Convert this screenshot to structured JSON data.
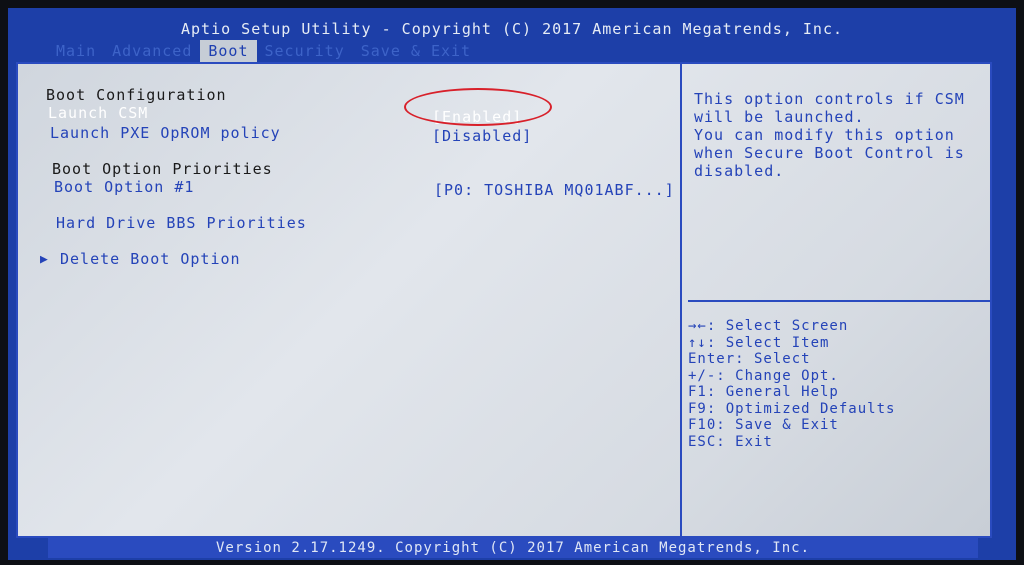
{
  "title": "Aptio Setup Utility - Copyright (C) 2017 American Megatrends, Inc.",
  "tabs": [
    {
      "label": "Main"
    },
    {
      "label": "Advanced"
    },
    {
      "label": "Boot"
    },
    {
      "label": "Security"
    },
    {
      "label": "Save & Exit"
    }
  ],
  "active_tab": "Boot",
  "boot": {
    "boot_configuration_heading": "Boot Configuration",
    "launch_csm_label": "Launch CSM",
    "launch_csm_value": "[Enabled]",
    "launch_pxe_label": "Launch PXE OpROM policy",
    "launch_pxe_value": "[Disabled]",
    "boot_option_priorities_heading": "Boot Option Priorities",
    "boot_option_1_label": "Boot Option #1",
    "boot_option_1_value": "[P0: TOSHIBA MQ01ABF...]",
    "hdd_bbs_label": "Hard Drive BBS Priorities",
    "delete_boot_label": "Delete Boot Option"
  },
  "help_text": [
    "This option controls if CSM",
    "will be launched.",
    "You can modify this option",
    "when Secure Boot Control is",
    "disabled."
  ],
  "key_help": [
    "→←: Select Screen",
    "↑↓: Select Item",
    "Enter: Select",
    "+/-: Change Opt.",
    "F1: General Help",
    "F9: Optimized Defaults",
    "F10: Save & Exit",
    "ESC: Exit"
  ],
  "footer": "Version 2.17.1249. Copyright (C) 2017 American Megatrends, Inc.",
  "colors": {
    "background": "#1d3fa8",
    "panel": "#d6dbe2",
    "text_blue": "#2443b8",
    "annotation_red": "#d8202a"
  }
}
